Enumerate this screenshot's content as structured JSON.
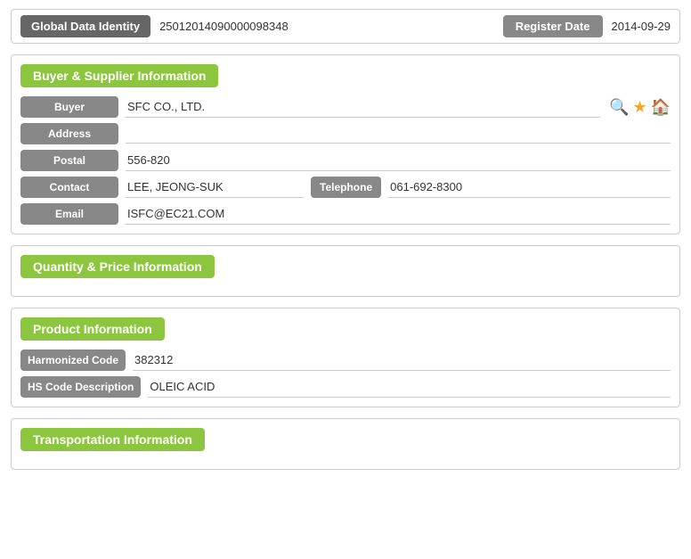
{
  "topBar": {
    "label": "Global Data Identity",
    "value": "25012014090000098348",
    "registerDateLabel": "Register Date",
    "registerDateValue": "2014-09-29"
  },
  "buyerSupplierSection": {
    "title": "Buyer & Supplier Information",
    "fields": {
      "buyer": {
        "label": "Buyer",
        "value": "SFC CO., LTD."
      },
      "address": {
        "label": "Address",
        "value": ""
      },
      "postal": {
        "label": "Postal",
        "value": "556-820"
      },
      "contact": {
        "label": "Contact",
        "value": "LEE, JEONG-SUK"
      },
      "telephone": {
        "label": "Telephone",
        "value": "061-692-8300"
      },
      "email": {
        "label": "Email",
        "value": "ISFC@EC21.COM"
      }
    },
    "icons": {
      "search": "🔍",
      "star": "★",
      "home": "🏠"
    }
  },
  "quantitySection": {
    "title": "Quantity & Price Information"
  },
  "productSection": {
    "title": "Product Information",
    "fields": {
      "harmonizedCode": {
        "label": "Harmonized Code",
        "value": "382312"
      },
      "hsCodeDescription": {
        "label": "HS Code Description",
        "value": "OLEIC ACID"
      }
    }
  },
  "transportationSection": {
    "title": "Transportation Information"
  }
}
